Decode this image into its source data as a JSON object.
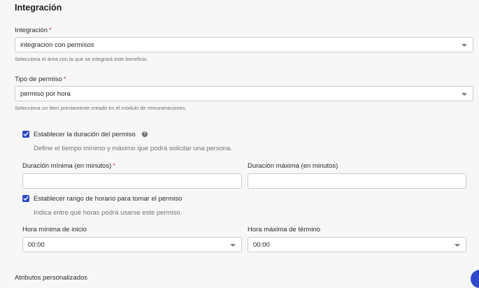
{
  "section": {
    "title": "Integración"
  },
  "integration": {
    "label": "Integración",
    "required_mark": "*",
    "value": "integracion con permisos",
    "help": "Selecciona el área con la que se integrará este beneficio."
  },
  "permit_type": {
    "label": "Tipo de permiso",
    "required_mark": "*",
    "value": "permiso por hora",
    "help": "Selecciona un ítem previamente creado en el módulo de remuneraciones."
  },
  "duration": {
    "checkbox_label": "Establecer la duración del permiso",
    "checked": true,
    "help_icon": "?",
    "description": "Define el tiempo mínimo y máximo que podrá solicitar una persona.",
    "min_label": "Duración mínima (en minutos)",
    "min_required_mark": "*",
    "min_value": "",
    "max_label": "Duración máxima (en minutos)",
    "max_value": ""
  },
  "schedule": {
    "checkbox_label": "Establecer rango de horario para tomar el permiso",
    "checked": true,
    "description": "Indica entre qué horas podrá usarse este permiso.",
    "start_label": "Hora mínima de inicio",
    "start_value": "00:00",
    "end_label": "Hora máxima de término",
    "end_value": "00:00"
  },
  "next_section": {
    "partial_label": "Atributos personalizados"
  },
  "colors": {
    "accent": "#2f49c9",
    "required": "#d33b3b",
    "border": "#c9ccd2",
    "background": "#f7f7f8"
  }
}
